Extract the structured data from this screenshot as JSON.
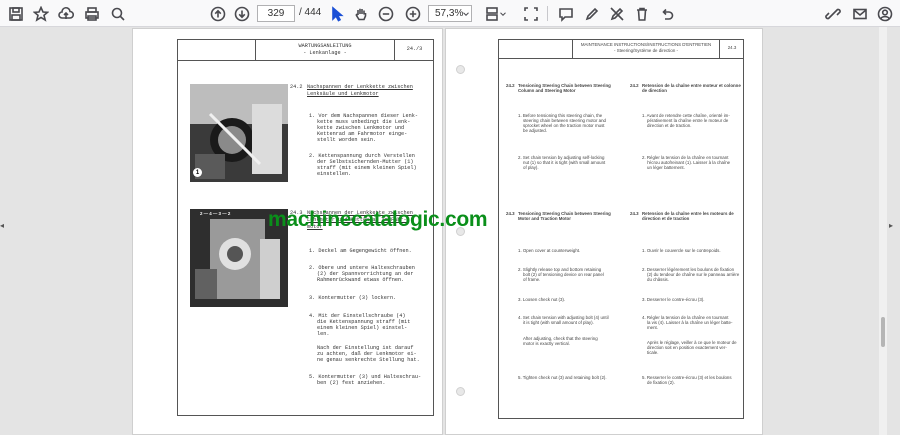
{
  "toolbar": {
    "page_current": "329",
    "page_total": "/ 444",
    "zoom": "57,3%"
  },
  "left_page": {
    "header_title": "WARTUNGSANLEITUNG",
    "header_subtitle": "- Lenkanlage -",
    "header_code": "24./3",
    "s1_heading_num": "24.2",
    "s1_heading": "Nachspannen der Lenkkette zwischen",
    "s1_heading2": "Lenksäule und Lenkmotor",
    "s1_step1": "1. Vor dem Nachspannen dieser Lenk-",
    "s1_step1b": "kette muss unbedingt die Lenk-",
    "s1_step1c": "kette zwischen Lenkmotor und",
    "s1_step1d": "Kettenrad am Fahrmotor einge-",
    "s1_step1e": "stellt worden sein.",
    "s1_step2": "2. Kettenspannung durch Verstellen",
    "s1_step2b": "der Selbstsichernden-Mutter (1)",
    "s1_step2c": "straff (mit einem kleinen Spiel)",
    "s1_step2d": "einstellen.",
    "s2_heading_num": "24.3",
    "s2_heading": "Nachspannen der Lenkkette zwischen",
    "s2_heading2": "Lenkmotor und Kettenrad am Fahr-",
    "s2_heading3": "motor",
    "s2_step1": "1. Deckel am Gegengewicht öffnen.",
    "s2_step2": "2. Obere und untere Halteschrauben",
    "s2_step2b": "(2) der Spannvorrichtung an der",
    "s2_step2c": "Rahmenrückwand etwas öffnen.",
    "s2_step3": "3. Kontermutter (3) lockern.",
    "s2_step4": "4. Mit der Einstellschraube (4)",
    "s2_step4b": "die Kettenspannung straff (mit",
    "s2_step4c": "einem kleinen Spiel) einstel-",
    "s2_step4d": "len.",
    "s2_note": "Nach der Einstellung ist darauf",
    "s2_noteb": "zu achten, daß der Lenkmotor ei-",
    "s2_notec": "ne genau senkrechte Stellung hat.",
    "s2_step5": "5. Kontermutter (3) und Halteschrau-",
    "s2_step5b": "ben (2) fest anziehen.",
    "photo1_label": "1",
    "photo2_labels": "2 — 4 — 3 — 2"
  },
  "right_page": {
    "header_title": "MAINTENANCE INSTRUCTIONS/INSTRUCTIONS D'ENTRETIEN",
    "header_subtitle": "- Steering/Système de direction -",
    "header_code": "24.3",
    "en1_num": "24.2",
    "en1_heading": "Tensioning Steering Chain between Steering",
    "en1_heading2": "Column and Steering Motor",
    "fr1_num": "24.2",
    "fr1_heading": "Retension de la chaîne entre moteur et colonne",
    "fr1_heading2": "de direction",
    "en1_step1": "1. Before tensioning this steering chain, the",
    "en1_step1b": "steering chain between steering motor and",
    "en1_step1c": "sprocket wheel on the traction motor must",
    "en1_step1d": "be adjusted.",
    "fr1_step1": "1. Avant de retendre cette chaîne, orienté im-",
    "fr1_step1b": "pérativement la chaîne entre le moteur de",
    "fr1_step1c": "direction et de traction.",
    "en1_step2": "2. Set chain tension by adjusting self-locking",
    "en1_step2b": "nut (1) so that it is tight (with small amount",
    "en1_step2c": "of play).",
    "fr1_step2": "2. Régler la tension de la chaîne en tournant",
    "fr1_step2b": "l'écrou autofreinant (1). Laisser à la chaîne",
    "fr1_step2c": "un léger battement.",
    "en2_num": "24.3",
    "en2_heading": "Tensioning Steering Chain between Steering",
    "en2_heading2": "Motor and Traction Motor",
    "fr2_num": "24.3",
    "fr2_heading": "Retension de la chaîne entre les moteurs de",
    "fr2_heading2": "direction et de traction",
    "en2_step1": "1. Open cover at counterweight.",
    "fr2_step1": "1. Ouvrir le couvercle sur le contrepoids.",
    "en2_step2": "2. Slightly release top and bottom retaining",
    "en2_step2b": "bolt (2) of tensioning device on rear panel",
    "en2_step2c": "of frame.",
    "fr2_step2": "2. Desserrer légèrement les boulons de fixation",
    "fr2_step2b": "(2) du tendeur de chaîne sur le panneau arrière",
    "fr2_step2c": "du châssis.",
    "en2_step3": "3. Loosen check nut (3).",
    "fr2_step3": "3. Desserrer le contre-écrou (3).",
    "en2_step4": "4. Set chain tension with adjusting bolt (4) until",
    "en2_step4b": "it is tight (with small amount of play).",
    "fr2_step4": "4. Régler la tension de la chaîne en tournant",
    "fr2_step4b": "la vis (4). Laisser à la chaîne un léger batte-",
    "fr2_step4c": "ment.",
    "en2_note": "After adjusting, check that the steering",
    "en2_noteb": "motor is exactly vertical.",
    "fr2_note": "Après le réglage, veiller à ce que le moteur de",
    "fr2_noteb": "direction soit en position exactement ver-",
    "fr2_notec": "ticale.",
    "en2_step5": "5. Tighten check nut (3) and retaining bolt (2).",
    "fr2_step5": "5. Resserrer le contre-écrou (3) et les boulons",
    "fr2_step5b": "de fixation (2)."
  },
  "watermark": "machinecatalogic.com"
}
